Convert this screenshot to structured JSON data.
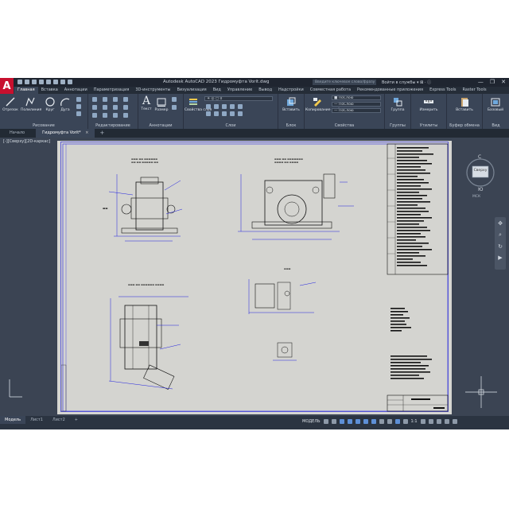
{
  "app": {
    "logo": "A",
    "title": "Autodesk AutoCAD 2023   Гидромуфта Vorit.dwg",
    "search_placeholder": "Введите ключевое слово/фразу",
    "user": "Войти в службы",
    "window_controls": [
      "—",
      "❐",
      "✕"
    ]
  },
  "ribbon_tabs": [
    "Главная",
    "Вставка",
    "Аннотации",
    "Параметризация",
    "3D-инструменты",
    "Визуализация",
    "Вид",
    "Управление",
    "Вывод",
    "Надстройки",
    "Совместная работа",
    "Рекомендованные приложения",
    "Express Tools",
    "Raster Tools"
  ],
  "ribbon": {
    "draw": {
      "label": "Рисование",
      "tools": [
        "Отрезок",
        "Полилиния",
        "Круг",
        "Дуга"
      ]
    },
    "modify": {
      "label": "Редактирование"
    },
    "annotation": {
      "label": "Аннотации",
      "tools": [
        "Текст",
        "Размер"
      ]
    },
    "layers": {
      "label": "Слои",
      "tool": "Свойства слоя",
      "current_layer": "0"
    },
    "block": {
      "label": "Блок",
      "tool": "Вставить"
    },
    "properties": {
      "label": "Свойства",
      "tool": "Копирование свойств",
      "color": "ПоСлою",
      "linetype": "ПоСлою",
      "lineweight": "ПоСлою"
    },
    "groups": {
      "label": "Группы",
      "tool": "Группа"
    },
    "utilities": {
      "label": "Утилиты",
      "tool": "Измерить"
    },
    "clipboard": {
      "label": "Буфер обмена",
      "tool": "Вставить"
    },
    "view": {
      "label": "Вид",
      "tool": "Базовый"
    }
  },
  "doc_tabs": {
    "start": "Начало",
    "drawing": "Гидромуфта Vorit*",
    "close": "×",
    "new": "+"
  },
  "viewport": {
    "label": "[-][Сверху][2D-каркас]",
    "viewcube_face": "Сверху",
    "viewcube_north": "С",
    "viewcube_south": "Ю",
    "wcs": "МСК"
  },
  "layout_tabs": [
    "Модель",
    "Лист1",
    "Лист2",
    "+"
  ],
  "status": {
    "model": "МОДЕЛЬ",
    "scale": "1:1"
  }
}
